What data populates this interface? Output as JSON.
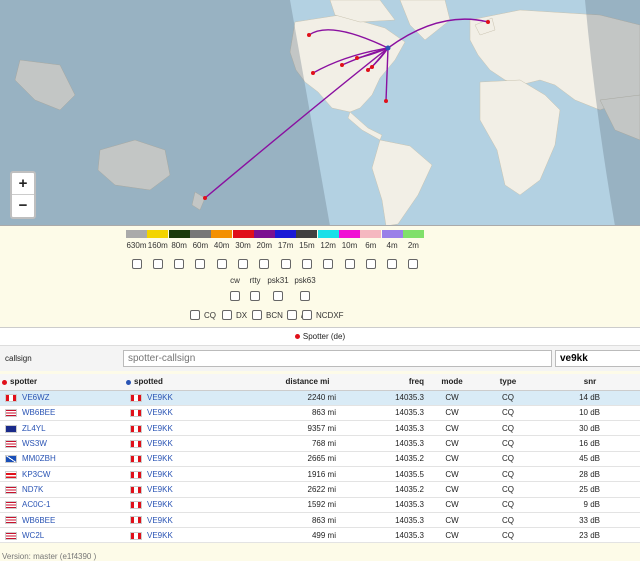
{
  "bands": [
    {
      "label": "630m",
      "color": "#aaaaaa"
    },
    {
      "label": "160m",
      "color": "#f3d400"
    },
    {
      "label": "80m",
      "color": "#1a3a0a"
    },
    {
      "label": "60m",
      "color": "#777777"
    },
    {
      "label": "40m",
      "color": "#f39000"
    },
    {
      "label": "30m",
      "color": "#e0101a"
    },
    {
      "label": "20m",
      "color": "#7b1090"
    },
    {
      "label": "17m",
      "color": "#1a1ad6"
    },
    {
      "label": "15m",
      "color": "#404040"
    },
    {
      "label": "12m",
      "color": "#19e0e8"
    },
    {
      "label": "10m",
      "color": "#f010d4"
    },
    {
      "label": "6m",
      "color": "#f5b8c0"
    },
    {
      "label": "4m",
      "color": "#9a80e8"
    },
    {
      "label": "2m",
      "color": "#80e06a"
    }
  ],
  "modes": [
    "cw",
    "rtty",
    "psk31",
    "psk63"
  ],
  "filters": [
    "CQ",
    "DX",
    "BCN",
    "/B",
    "NCDXF"
  ],
  "spotter_header": "Spotter (de)",
  "callsign_label": "callsign",
  "callsign_placeholder": "spotter-callsign",
  "callsign_value": "ve9kk",
  "columns": {
    "spotter": "spotter",
    "spotted": "spotted",
    "distance": "distance mi",
    "freq": "freq",
    "mode": "mode",
    "type": "type",
    "snr": "snr"
  },
  "rows": [
    {
      "spotter": "VE6WZ",
      "spotter_flag": "ca",
      "spotted": "VE9KK",
      "distance": "2240",
      "freq": "14035.3",
      "mode": "CW",
      "type": "CQ",
      "snr": "14 dB",
      "selected": true
    },
    {
      "spotter": "WB6BEE",
      "spotter_flag": "us",
      "spotted": "VE9KK",
      "distance": "863",
      "freq": "14035.3",
      "mode": "CW",
      "type": "CQ",
      "snr": "10 dB"
    },
    {
      "spotter": "ZL4YL",
      "spotter_flag": "nz",
      "spotted": "VE9KK",
      "distance": "9357",
      "freq": "14035.3",
      "mode": "CW",
      "type": "CQ",
      "snr": "30 dB"
    },
    {
      "spotter": "WS3W",
      "spotter_flag": "us",
      "spotted": "VE9KK",
      "distance": "768",
      "freq": "14035.3",
      "mode": "CW",
      "type": "CQ",
      "snr": "16 dB"
    },
    {
      "spotter": "MM0ZBH",
      "spotter_flag": "sc",
      "spotted": "VE9KK",
      "distance": "2665",
      "freq": "14035.2",
      "mode": "CW",
      "type": "CQ",
      "snr": "45 dB"
    },
    {
      "spotter": "KP3CW",
      "spotter_flag": "pr",
      "spotted": "VE9KK",
      "distance": "1916",
      "freq": "14035.5",
      "mode": "CW",
      "type": "CQ",
      "snr": "28 dB"
    },
    {
      "spotter": "ND7K",
      "spotter_flag": "us",
      "spotted": "VE9KK",
      "distance": "2622",
      "freq": "14035.2",
      "mode": "CW",
      "type": "CQ",
      "snr": "25 dB"
    },
    {
      "spotter": "AC0C-1",
      "spotter_flag": "us",
      "spotted": "VE9KK",
      "distance": "1592",
      "freq": "14035.3",
      "mode": "CW",
      "type": "CQ",
      "snr": "9 dB"
    },
    {
      "spotter": "WB6BEE",
      "spotter_flag": "us",
      "spotted": "VE9KK",
      "distance": "863",
      "freq": "14035.3",
      "mode": "CW",
      "type": "CQ",
      "snr": "33 dB"
    },
    {
      "spotter": "WC2L",
      "spotter_flag": "us",
      "spotted": "VE9KK",
      "distance": "499",
      "freq": "14035.3",
      "mode": "CW",
      "type": "CQ",
      "snr": "23 dB"
    }
  ],
  "distance_unit": "mi",
  "version": "Version: master (e1f4390 )",
  "colors": {
    "path": "#8a10a0",
    "spot": "#e0101a",
    "link": "#2a54b4",
    "land": "#f2efe6",
    "water": "#b3d1e2",
    "night": "#8a9aa8"
  }
}
